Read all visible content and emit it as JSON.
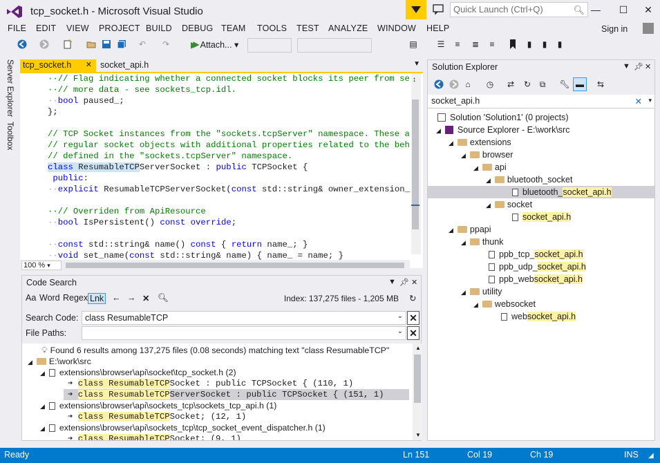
{
  "window": {
    "title": "tcp_socket.h - Microsoft Visual Studio",
    "quick_launch_placeholder": "Quick Launch (Ctrl+Q)"
  },
  "menu": [
    "FILE",
    "EDIT",
    "VIEW",
    "PROJECT",
    "BUILD",
    "DEBUG",
    "TEAM",
    "TOOLS",
    "TEST",
    "ANALYZE",
    "WINDOW",
    "HELP"
  ],
  "account": {
    "signin": "Sign in"
  },
  "toolbar": {
    "attach_label": "Attach...",
    "icons": [
      "back-icon",
      "forward-icon",
      "new-project-icon",
      "open-icon",
      "save-icon",
      "save-all-icon",
      "undo-icon",
      "redo-icon",
      "start-icon"
    ]
  },
  "left_tabs": [
    "Server Explorer",
    "Toolbox"
  ],
  "doc_tabs": [
    {
      "label": "tcp_socket.h",
      "active": true
    },
    {
      "label": "socket_api.h",
      "active": false
    }
  ],
  "editor": {
    "zoom": "100 %",
    "lines": [
      "··// Flag indicating whether a connected socket blocks its peer from sendin",
      "··// more data - see sockets_tcp.idl.",
      "··bool paused_;",
      "};",
      "",
      "// TCP Socket instances from the \"sockets.tcpServer\" namespace. These are",
      "// regular socket objects with additional properties related to the behavio",
      "// defined in the \"sockets.tcpServer\" namespace.",
      "class ResumableTCPServerSocket : public TCPSocket {",
      " public:",
      "··explicit ResumableTCPServerSocket(const std::string& owner_extension_id);",
      "",
      "··// Overriden from ApiResource",
      "··bool IsPersistent() const override;",
      "",
      "··const std::string& name() const { return name_; }",
      "··void set_name(const std::string& name) { name_ = name; }"
    ]
  },
  "code_search": {
    "title": "Code Search",
    "toggles": [
      "Aa",
      "Word",
      "Regex",
      "Lnk"
    ],
    "index_info": "Index: 137,275 files - 1,205 MB",
    "search_code_label": "Search Code:",
    "search_code_value": "class ResumableTCP",
    "file_paths_label": "File Paths:",
    "file_paths_value": "",
    "summary": "Found 6 results among 137,275 files (0.08 seconds) matching text \"class ResumableTCP\"",
    "root": "E:\\work\\src",
    "files": [
      {
        "path": "extensions\\browser\\api\\socket\\tcp_socket.h (2)",
        "matches": [
          {
            "match": "class ResumableTCP",
            "rest": "Socket : public TCPSocket { (110, 1)"
          },
          {
            "match": "class ResumableTCP",
            "rest": "ServerSocket : public TCPSocket { (151, 1)"
          }
        ]
      },
      {
        "path": "extensions\\browser\\api\\sockets_tcp\\sockets_tcp_api.h (1)",
        "matches": [
          {
            "match": "class ResumableTCP",
            "rest": "Socket; (12, 1)"
          }
        ]
      },
      {
        "path": "extensions\\browser\\api\\sockets_tcp\\tcp_socket_event_dispatcher.h (1)",
        "matches": [
          {
            "match": "class ResumableTCP",
            "rest": "Socket; (9, 1)"
          }
        ]
      }
    ]
  },
  "solution_explorer": {
    "title": "Solution Explorer",
    "search_value": "socket_api.h",
    "tree": [
      {
        "label": "Solution 'Solution1' (0 projects)",
        "pre": "",
        "hl": ""
      },
      {
        "label": "Source Explorer - E:\\work\\src",
        "pre": "",
        "hl": ""
      },
      {
        "label": "extensions",
        "pre": "",
        "hl": ""
      },
      {
        "label": "browser",
        "pre": "",
        "hl": ""
      },
      {
        "label": "api",
        "pre": "",
        "hl": ""
      },
      {
        "label": "bluetooth_socket",
        "pre": "",
        "hl": ""
      },
      {
        "label": "",
        "pre": "bluetooth_",
        "hl": "socket_api.h"
      },
      {
        "label": "socket",
        "pre": "",
        "hl": ""
      },
      {
        "label": "",
        "pre": "",
        "hl": "socket_api.h"
      },
      {
        "label": "ppapi",
        "pre": "",
        "hl": ""
      },
      {
        "label": "thunk",
        "pre": "",
        "hl": ""
      },
      {
        "label": "",
        "pre": "ppb_tcp_",
        "hl": "socket_api.h"
      },
      {
        "label": "",
        "pre": "ppb_udp_",
        "hl": "socket_api.h"
      },
      {
        "label": "",
        "pre": "ppb_web",
        "hl": "socket_api.h"
      },
      {
        "label": "utility",
        "pre": "",
        "hl": ""
      },
      {
        "label": "websocket",
        "pre": "",
        "hl": ""
      },
      {
        "label": "",
        "pre": "web",
        "hl": "socket_api.h"
      }
    ]
  },
  "status": {
    "ready": "Ready",
    "ln": "Ln 151",
    "col": "Col 19",
    "ch": "Ch 19",
    "ins": "INS"
  },
  "colors": {
    "accent": "#007acc",
    "tab_active": "#ffcc00",
    "highlight": "#fdf2a5"
  }
}
